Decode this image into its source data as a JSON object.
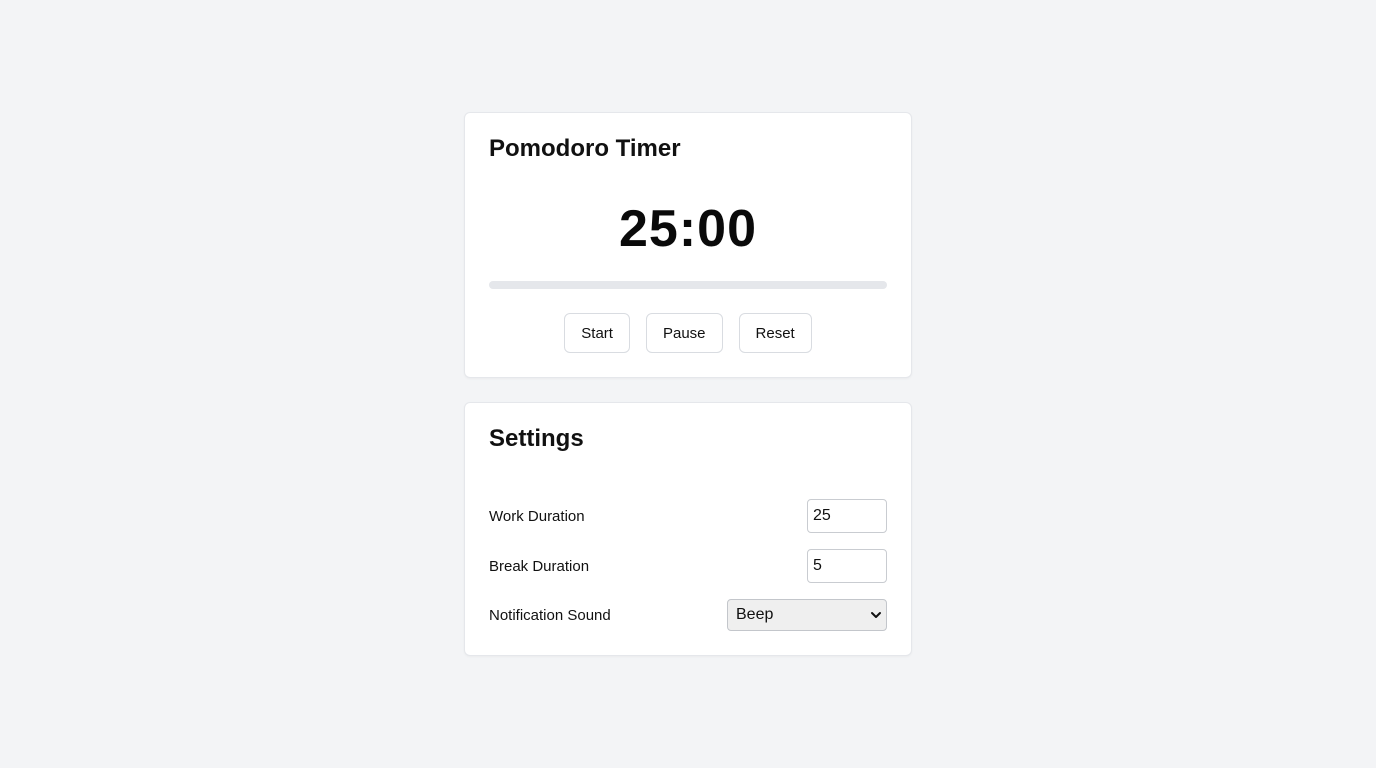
{
  "timer": {
    "title": "Pomodoro Timer",
    "time": "25:00",
    "progress_percent": 0,
    "buttons": {
      "start": "Start",
      "pause": "Pause",
      "reset": "Reset"
    }
  },
  "settings": {
    "title": "Settings",
    "work_duration": {
      "label": "Work Duration",
      "value": "25"
    },
    "break_duration": {
      "label": "Break Duration",
      "value": "5"
    },
    "notification_sound": {
      "label": "Notification Sound",
      "selected": "Beep",
      "icon": "chevron-down-icon"
    }
  },
  "colors": {
    "page_background": "#f3f4f6",
    "card_background": "#ffffff",
    "progress_track": "#e5e7eb"
  }
}
